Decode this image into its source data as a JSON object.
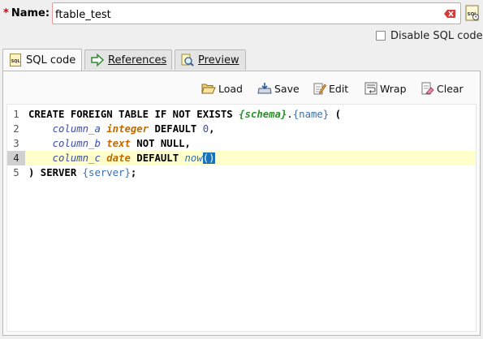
{
  "form": {
    "name_required_mark": "*",
    "name_label": "Name:",
    "name_value": "ftable_test",
    "disable_sql_label": "Disable SQL code"
  },
  "tabs": [
    {
      "label": "SQL code",
      "active": true
    },
    {
      "label": "References",
      "active": false
    },
    {
      "label": "Preview",
      "active": false
    }
  ],
  "toolbar": {
    "load_label": "Load",
    "save_label": "Save",
    "edit_label": "Edit",
    "wrap_label": "Wrap",
    "clear_label": "Clear"
  },
  "editor": {
    "current_line": 4,
    "lines": [
      {
        "number": "1",
        "tokens": [
          {
            "text": "CREATE FOREIGN TABLE IF NOT EXISTS ",
            "cls": "kw"
          },
          {
            "text": "{schema}",
            "cls": "schema"
          },
          {
            "text": ".",
            "cls": ""
          },
          {
            "text": "{name}",
            "cls": "tmpl"
          },
          {
            "text": " (",
            "cls": "kw"
          }
        ]
      },
      {
        "number": "2",
        "tokens": [
          {
            "text": "    ",
            "cls": ""
          },
          {
            "text": "column_a",
            "cls": "ident"
          },
          {
            "text": " ",
            "cls": ""
          },
          {
            "text": "integer",
            "cls": "type"
          },
          {
            "text": " DEFAULT ",
            "cls": "kw"
          },
          {
            "text": "0",
            "cls": "num"
          },
          {
            "text": ",",
            "cls": "kw"
          }
        ]
      },
      {
        "number": "3",
        "tokens": [
          {
            "text": "    ",
            "cls": ""
          },
          {
            "text": "column_b",
            "cls": "ident"
          },
          {
            "text": " ",
            "cls": ""
          },
          {
            "text": "text",
            "cls": "type"
          },
          {
            "text": " NOT NULL,",
            "cls": "kw"
          }
        ]
      },
      {
        "number": "4",
        "tokens": [
          {
            "text": "    ",
            "cls": ""
          },
          {
            "text": "column_c",
            "cls": "ident"
          },
          {
            "text": " ",
            "cls": ""
          },
          {
            "text": "date",
            "cls": "type"
          },
          {
            "text": " DEFAULT ",
            "cls": "kw"
          },
          {
            "text": "now",
            "cls": "func"
          },
          {
            "text": "()",
            "cls": "bracket-hl"
          }
        ]
      },
      {
        "number": "5",
        "tokens": [
          {
            "text": ") SERVER ",
            "cls": "kw"
          },
          {
            "text": "{server}",
            "cls": "tmpl"
          },
          {
            "text": ";",
            "cls": "kw"
          }
        ]
      }
    ]
  },
  "colors": {
    "required": "#d40000",
    "current_line_bg": "#ffffcc",
    "bracket_highlight": "#1a72b8"
  },
  "icons": {
    "name_field_right": "sql-code-icon",
    "clear_input": "eraser-icon",
    "tab_sql_code": "sql-file-icon",
    "tab_references": "arrow-right-icon",
    "tab_preview": "magnifier-icon",
    "load": "folder-open-icon",
    "save": "save-icon",
    "edit": "pencil-icon",
    "wrap": "wrap-icon",
    "clear": "eraser-icon"
  }
}
